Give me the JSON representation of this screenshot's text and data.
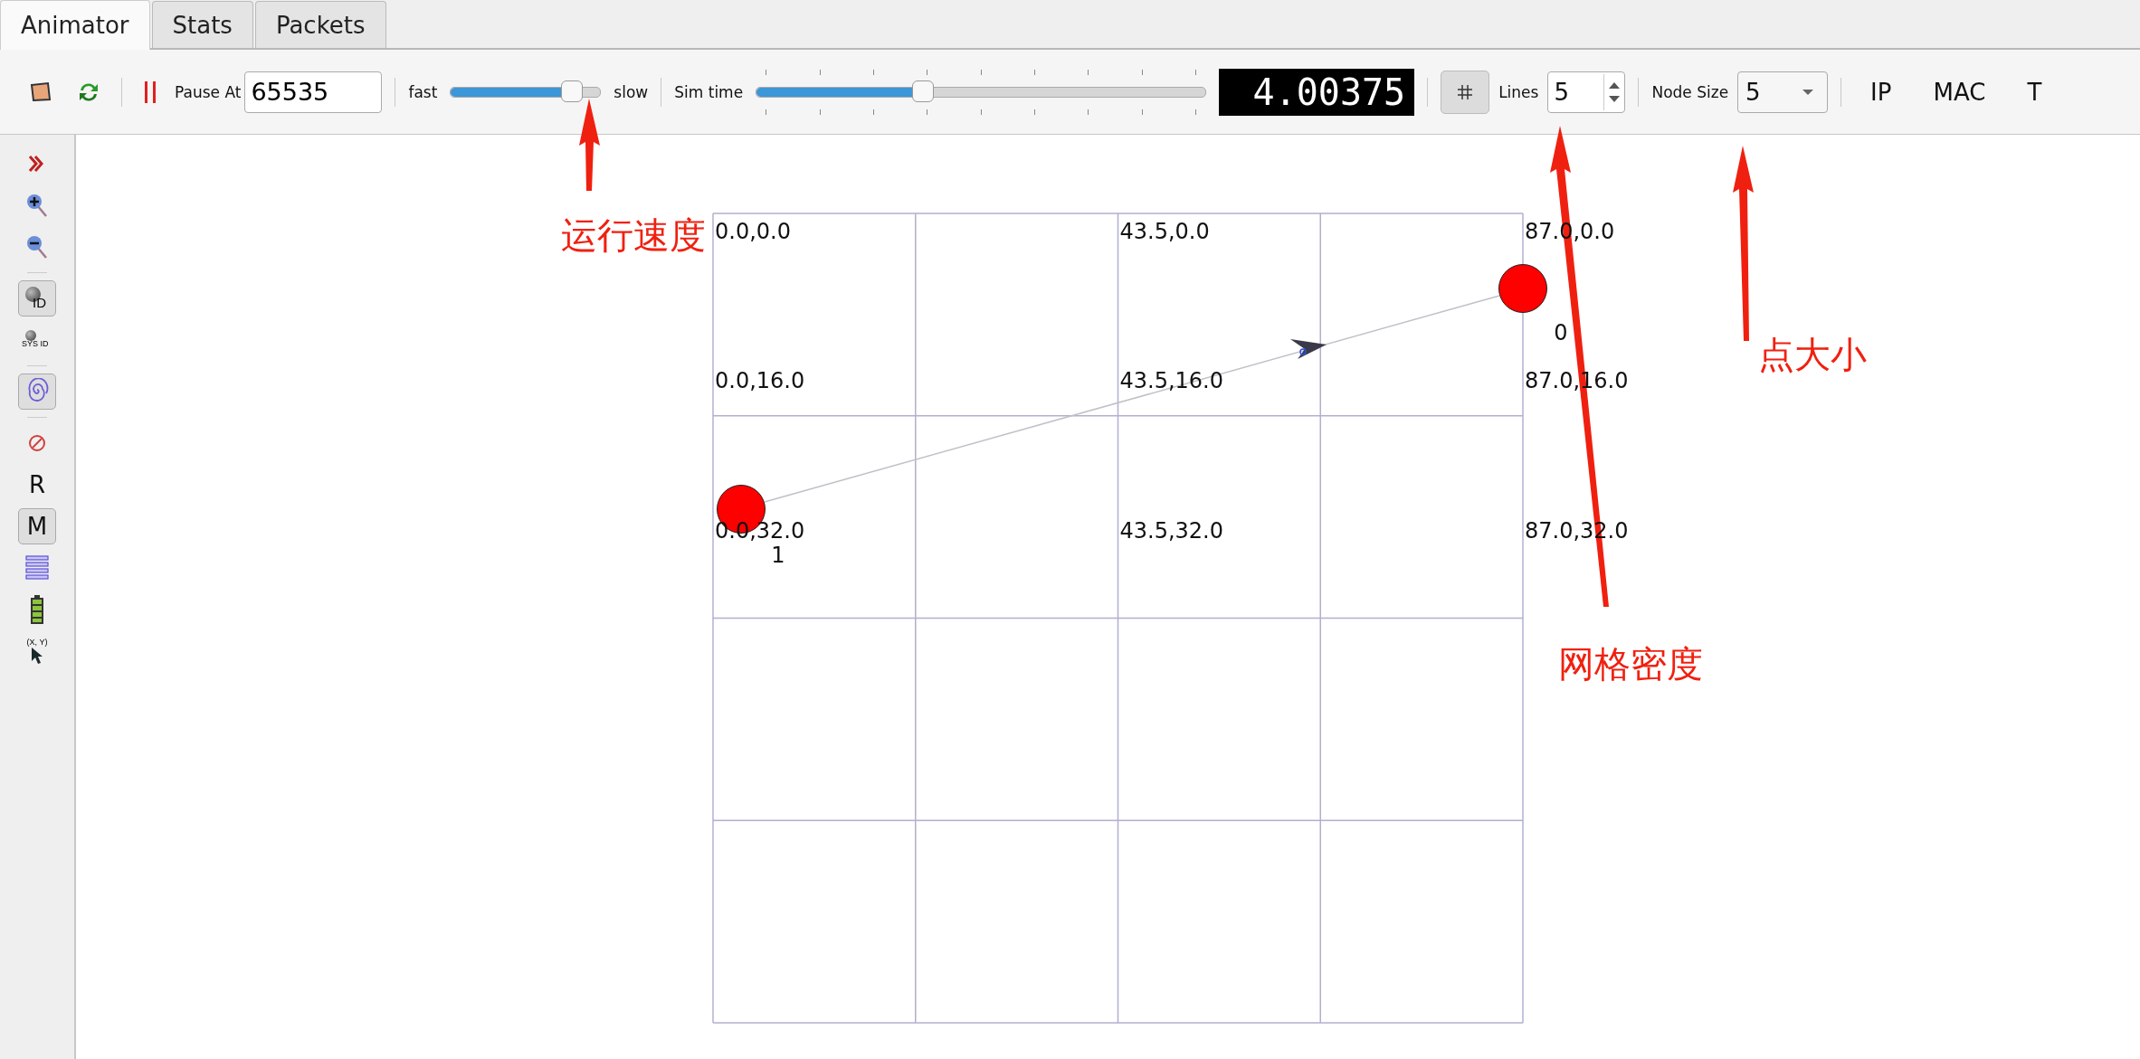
{
  "tabs": [
    {
      "label": "Animator",
      "selected": true
    },
    {
      "label": "Stats",
      "selected": false
    },
    {
      "label": "Packets",
      "selected": false
    }
  ],
  "toolbar": {
    "pause_at_label": "Pause At",
    "pause_at_value": "65535",
    "speed_fast": "fast",
    "speed_slow": "slow",
    "speed_slider": {
      "level": 0.81
    },
    "sim_time_label": "Sim time",
    "sim_time_slider": {
      "level": 0.37
    },
    "sim_time_display": "4.00375",
    "grid_on": true,
    "lines_label": "Lines",
    "lines_value": "5",
    "node_size_label": "Node Size",
    "node_size_value": "5",
    "ip": "IP",
    "mac": "MAC",
    "t": "T"
  },
  "sidebar": {
    "items": [
      {
        "kind": "icon",
        "on": false
      },
      {
        "kind": "icon",
        "on": false
      },
      {
        "kind": "icon",
        "on": false
      },
      {
        "kind": "separator"
      },
      {
        "kind": "icon-label",
        "label": "ID",
        "on": true
      },
      {
        "kind": "icon-label",
        "label": "SYS ID",
        "on": false
      },
      {
        "kind": "separator"
      },
      {
        "kind": "icon",
        "on": true
      },
      {
        "kind": "separator"
      },
      {
        "kind": "icon",
        "on": false
      },
      {
        "kind": "text",
        "label": "R",
        "on": false
      },
      {
        "kind": "text",
        "label": "M",
        "on": true
      },
      {
        "kind": "icon",
        "on": false
      },
      {
        "kind": "icon",
        "on": false
      },
      {
        "kind": "icon-label",
        "label": "(X, Y)",
        "on": false
      }
    ]
  },
  "canvas": {
    "grid_labels": [
      "0.0,0.0",
      "43.5,0.0",
      "87.0,0.0",
      "0.0,16.0",
      "43.5,16.0",
      "87.0,16.0",
      "0.0,32.0",
      "43.5,32.0",
      "87.0,32.0"
    ],
    "nodes": [
      {
        "label": "0"
      },
      {
        "label": "1"
      }
    ]
  },
  "annotations": [
    {
      "text": "运行速度"
    },
    {
      "text": "网格密度"
    },
    {
      "text": "点大小"
    }
  ]
}
